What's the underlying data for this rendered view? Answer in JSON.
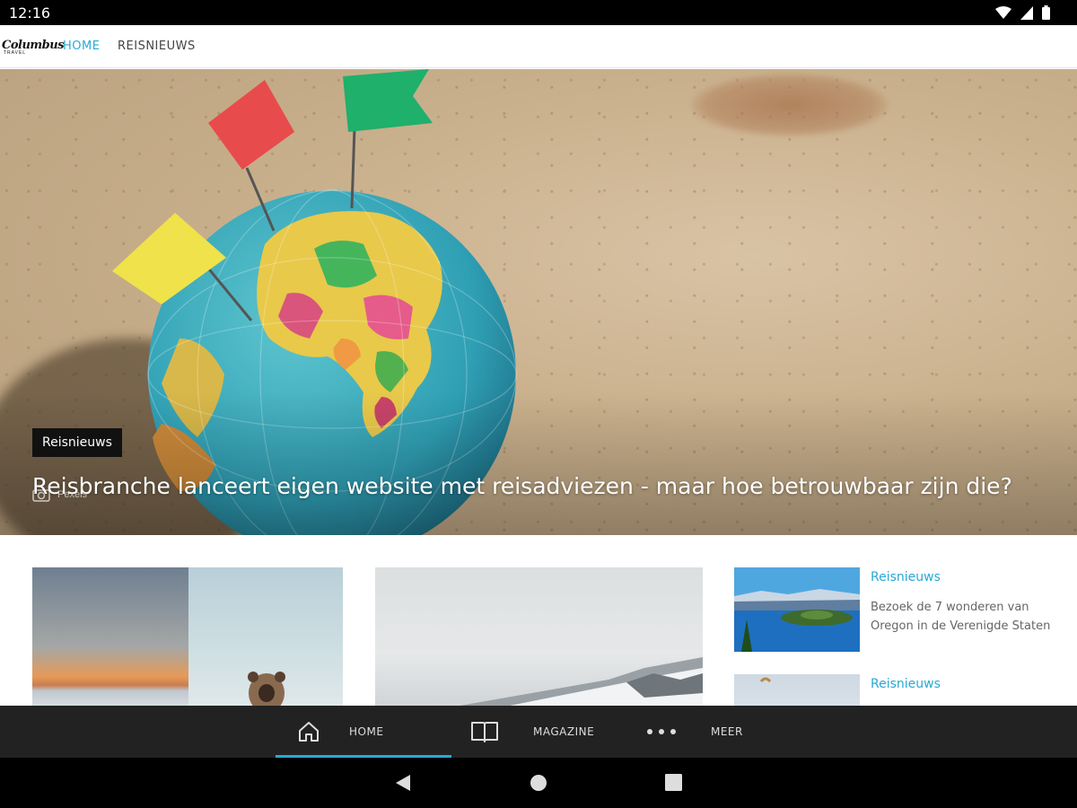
{
  "status_bar": {
    "time": "12:16"
  },
  "top_nav": {
    "logo_text": "Columbus",
    "logo_sub": "TRAVEL",
    "tabs": [
      {
        "label": "HOME",
        "active": true
      },
      {
        "label": "REISNIEUWS",
        "active": false
      }
    ]
  },
  "hero": {
    "category": "Reisnieuws",
    "title": "Reisbranche lanceert eigen website met reisadviezen - maar hoe betrouwbaar zijn die?",
    "photo_credit": "Pexels"
  },
  "side_articles": [
    {
      "category": "Reisnieuws",
      "title": "Bezoek de 7 wonderen van Oregon in de Verenigde Staten"
    },
    {
      "category": "Reisnieuws",
      "title": ""
    }
  ],
  "bottom_nav": {
    "items": [
      {
        "label": "HOME",
        "icon": "home-icon",
        "active": true
      },
      {
        "label": "MAGAZINE",
        "icon": "book-icon",
        "active": false
      },
      {
        "label": "MEER",
        "icon": "more-icon",
        "active": false
      }
    ]
  },
  "colors": {
    "accent": "#2aa8d6",
    "bottom_bar": "#222222"
  }
}
